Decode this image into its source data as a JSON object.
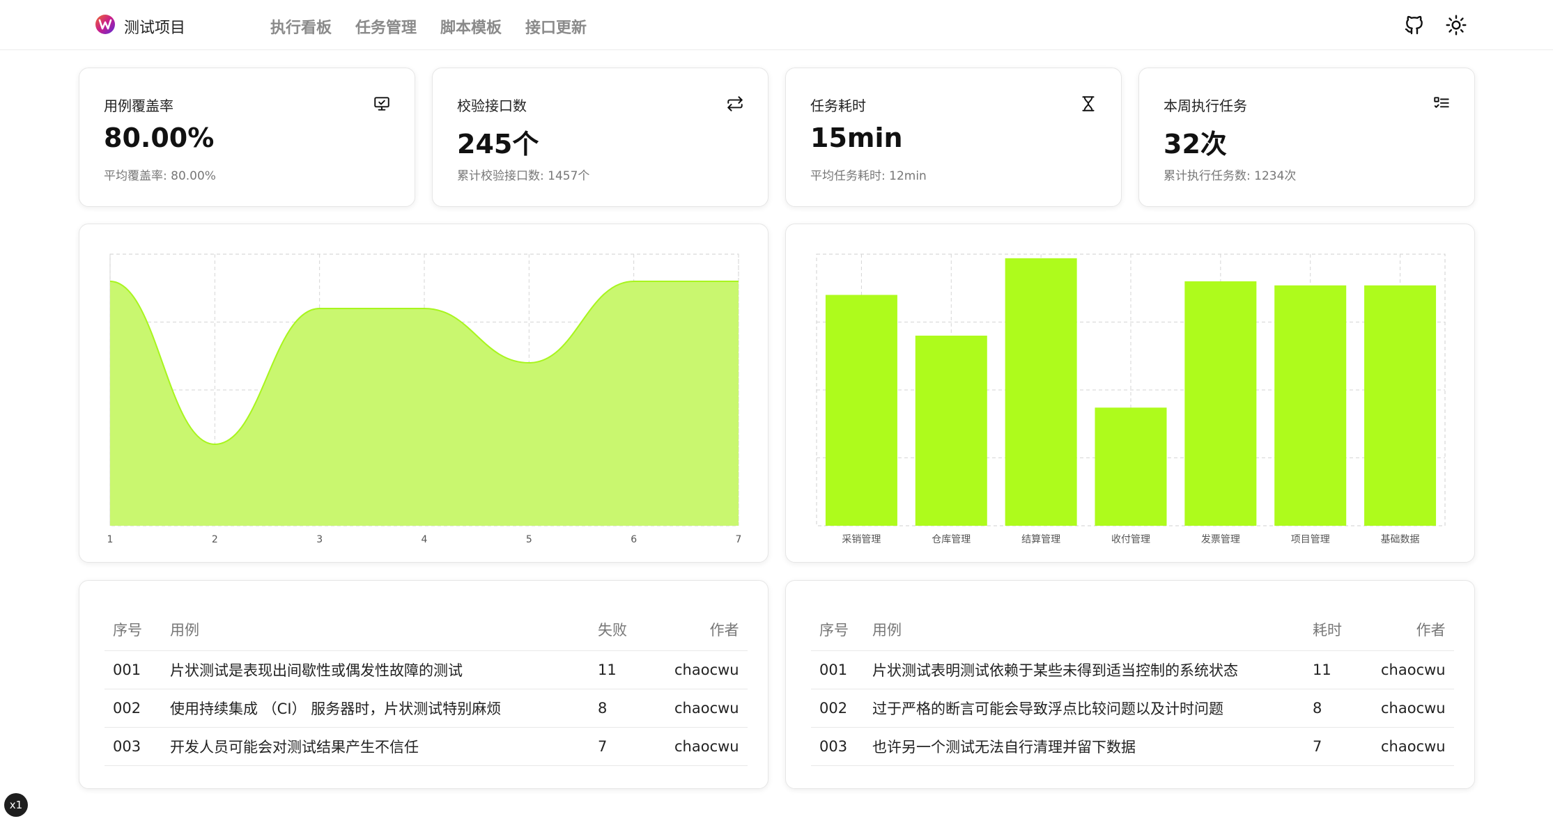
{
  "header": {
    "app_title": "测试项目",
    "nav": [
      "执行看板",
      "任务管理",
      "脚本模板",
      "接口更新"
    ],
    "icons": [
      "github-icon",
      "sun-icon"
    ]
  },
  "stats": [
    {
      "title": "用例覆盖率",
      "value": "80.00%",
      "sub": "平均覆盖率: 80.00%",
      "icon": "monitor-check-icon"
    },
    {
      "title": "校验接口数",
      "value": "245个",
      "sub": "累计校验接口数: 1457个",
      "icon": "swap-arrows-icon"
    },
    {
      "title": "任务耗时",
      "value": "15min",
      "sub": "平均任务耗时: 12min",
      "icon": "hourglass-icon"
    },
    {
      "title": "本周执行任务",
      "value": "32次",
      "sub": "累计执行任务数: 1234次",
      "icon": "task-list-icon"
    }
  ],
  "chart_data": [
    {
      "type": "area",
      "x": [
        "1",
        "2",
        "3",
        "4",
        "5",
        "6",
        "7"
      ],
      "values": [
        90,
        30,
        80,
        80,
        60,
        90,
        90
      ],
      "ylim": [
        0,
        100
      ],
      "grid": true,
      "color": "#c9f76f",
      "line_color": "#a8f51e"
    },
    {
      "type": "bar",
      "categories": [
        "采销管理",
        "仓库管理",
        "结算管理",
        "收付管理",
        "发票管理",
        "项目管理",
        "基础数据"
      ],
      "values": [
        85,
        70,
        98.5,
        43.5,
        90,
        88.5,
        88.5
      ],
      "ylim": [
        0,
        100
      ],
      "grid": true,
      "color": "#aefb1c"
    }
  ],
  "tables": [
    {
      "headers": [
        "序号",
        "用例",
        "失败",
        "作者"
      ],
      "rows": [
        [
          "001",
          "片状测试是表现出间歇性或偶发性故障的测试",
          "11",
          "chaocwu"
        ],
        [
          "002",
          "使用持续集成 （CI） 服务器时，片状测试特别麻烦",
          "8",
          "chaocwu"
        ],
        [
          "003",
          "开发人员可能会对测试结果产生不信任",
          "7",
          "chaocwu"
        ]
      ]
    },
    {
      "headers": [
        "序号",
        "用例",
        "耗时",
        "作者"
      ],
      "rows": [
        [
          "001",
          "片状测试表明测试依赖于某些未得到适当控制的系统状态",
          "11",
          "chaocwu"
        ],
        [
          "002",
          "过于严格的断言可能会导致浮点比较问题以及计时问题",
          "8",
          "chaocwu"
        ],
        [
          "003",
          "也许另一个测试无法自行清理并留下数据",
          "7",
          "chaocwu"
        ]
      ]
    }
  ],
  "badge": "x1"
}
